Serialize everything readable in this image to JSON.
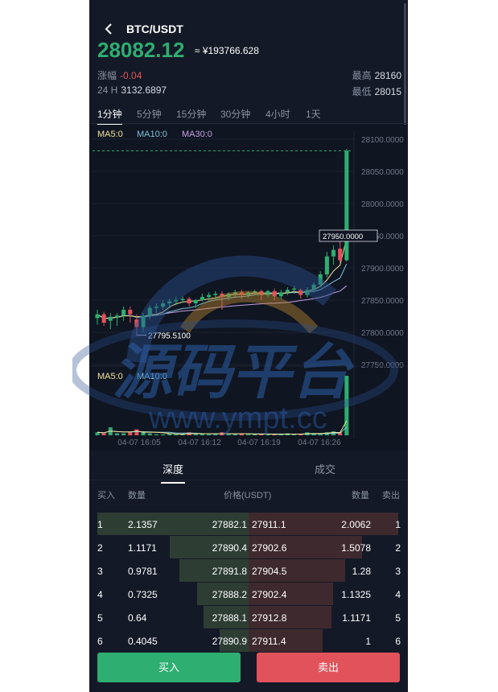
{
  "header": {
    "title": "BTC/USDT"
  },
  "price": {
    "last": "28082.12",
    "approx": "≈ ¥193766.628"
  },
  "stats": {
    "change_label": "涨幅",
    "change_value": "-0.04",
    "vol_label": "24 H",
    "vol_value": "3132.6897",
    "high_label": "最高",
    "high_value": "28160",
    "low_label": "最低",
    "low_value": "28015"
  },
  "intervals": [
    "1分钟",
    "5分钟",
    "15分钟",
    "30分钟",
    "4小时",
    "1天"
  ],
  "ma_main": {
    "ma5": "MA5:0",
    "ma10": "MA10:0",
    "ma30": "MA30:0"
  },
  "ma_vol": {
    "ma5": "MA5:0",
    "ma10": "MA10:0"
  },
  "chart_data": {
    "type": "candlestick",
    "y_ticks": [
      "28100.0000",
      "28050.0000",
      "28000.0000",
      "27950.0000",
      "27900.0000",
      "27850.0000",
      "27800.0000",
      "27750.0000"
    ],
    "ylim": [
      27750,
      28100
    ],
    "x_ticks": [
      "04-07 16:05",
      "04-07 16:12",
      "04-07 16:19",
      "04-07 16:26"
    ],
    "last_price_label": "27950.0000",
    "low_label": "27795.5100",
    "candles": [
      {
        "o": 27822,
        "h": 27835,
        "c": 27828,
        "l": 27812
      },
      {
        "o": 27828,
        "h": 27832,
        "c": 27815,
        "l": 27810
      },
      {
        "o": 27818,
        "h": 27830,
        "c": 27824,
        "l": 27805
      },
      {
        "o": 27823,
        "h": 27830,
        "c": 27826,
        "l": 27810
      },
      {
        "o": 27826,
        "h": 27840,
        "c": 27835,
        "l": 27818
      },
      {
        "o": 27835,
        "h": 27840,
        "c": 27828,
        "l": 27815
      },
      {
        "o": 27820,
        "h": 27828,
        "c": 27808,
        "l": 27795
      },
      {
        "o": 27808,
        "h": 27830,
        "c": 27826,
        "l": 27800
      },
      {
        "o": 27826,
        "h": 27842,
        "c": 27838,
        "l": 27820
      },
      {
        "o": 27838,
        "h": 27845,
        "c": 27840,
        "l": 27830
      },
      {
        "o": 27840,
        "h": 27850,
        "c": 27845,
        "l": 27835
      },
      {
        "o": 27845,
        "h": 27852,
        "c": 27848,
        "l": 27840
      },
      {
        "o": 27848,
        "h": 27855,
        "c": 27850,
        "l": 27842
      },
      {
        "o": 27850,
        "h": 27856,
        "c": 27852,
        "l": 27846
      },
      {
        "o": 27852,
        "h": 27855,
        "c": 27845,
        "l": 27840
      },
      {
        "o": 27845,
        "h": 27852,
        "c": 27850,
        "l": 27838
      },
      {
        "o": 27850,
        "h": 27860,
        "c": 27855,
        "l": 27848
      },
      {
        "o": 27855,
        "h": 27862,
        "c": 27858,
        "l": 27850
      },
      {
        "o": 27858,
        "h": 27864,
        "c": 27860,
        "l": 27852
      },
      {
        "o": 27860,
        "h": 27864,
        "c": 27855,
        "l": 27835
      },
      {
        "o": 27855,
        "h": 27862,
        "c": 27860,
        "l": 27850
      },
      {
        "o": 27860,
        "h": 27866,
        "c": 27862,
        "l": 27855
      },
      {
        "o": 27862,
        "h": 27866,
        "c": 27858,
        "l": 27852
      },
      {
        "o": 27858,
        "h": 27864,
        "c": 27862,
        "l": 27854
      },
      {
        "o": 27862,
        "h": 27866,
        "c": 27864,
        "l": 27858
      },
      {
        "o": 27864,
        "h": 27866,
        "c": 27858,
        "l": 27850
      },
      {
        "o": 27858,
        "h": 27866,
        "c": 27864,
        "l": 27854
      },
      {
        "o": 27864,
        "h": 27868,
        "c": 27856,
        "l": 27850
      },
      {
        "o": 27856,
        "h": 27866,
        "c": 27862,
        "l": 27852
      },
      {
        "o": 27862,
        "h": 27870,
        "c": 27866,
        "l": 27858
      },
      {
        "o": 27866,
        "h": 27872,
        "c": 27868,
        "l": 27860
      },
      {
        "o": 27866,
        "h": 27868,
        "c": 27858,
        "l": 27852
      },
      {
        "o": 27858,
        "h": 27870,
        "c": 27866,
        "l": 27854
      },
      {
        "o": 27866,
        "h": 27878,
        "c": 27874,
        "l": 27862
      },
      {
        "o": 27874,
        "h": 27895,
        "c": 27890,
        "l": 27870
      },
      {
        "o": 27890,
        "h": 27925,
        "c": 27918,
        "l": 27885
      },
      {
        "o": 27918,
        "h": 27935,
        "c": 27928,
        "l": 27905
      },
      {
        "o": 27930,
        "h": 27945,
        "c": 27912,
        "l": 27908
      },
      {
        "o": 27912,
        "h": 28085,
        "c": 28082,
        "l": 27910
      }
    ],
    "volumes": [
      3,
      2,
      8,
      2,
      2,
      3,
      6,
      3,
      2,
      1,
      1,
      2,
      1,
      1,
      3,
      1,
      2,
      1,
      1,
      3,
      1,
      1,
      2,
      1,
      1,
      1,
      1,
      1,
      1,
      2,
      1,
      1,
      3,
      2,
      2,
      3,
      4,
      3,
      60
    ]
  },
  "depth_tabs": [
    "深度",
    "成交"
  ],
  "orderbook": {
    "headers": {
      "buy": "买入",
      "qty": "数量",
      "price": "价格(USDT)",
      "qty2": "数量",
      "sell": "卖出"
    },
    "rows": [
      {
        "n": "1",
        "bq": "2.1357",
        "bp": "27882.1",
        "ap": "27911.1",
        "aq": "2.0062",
        "m": "1",
        "bd": 1.0,
        "ad": 0.99
      },
      {
        "n": "2",
        "bq": "1.1171",
        "bp": "27890.4",
        "ap": "27902.6",
        "aq": "1.5078",
        "m": "2",
        "bd": 0.52,
        "ad": 0.75
      },
      {
        "n": "3",
        "bq": "0.9781",
        "bp": "27891.8",
        "ap": "27904.5",
        "aq": "1.28",
        "m": "3",
        "bd": 0.46,
        "ad": 0.64
      },
      {
        "n": "4",
        "bq": "0.7325",
        "bp": "27888.2",
        "ap": "27902.4",
        "aq": "1.1325",
        "m": "4",
        "bd": 0.34,
        "ad": 0.56
      },
      {
        "n": "5",
        "bq": "0.64",
        "bp": "27888.1",
        "ap": "27912.8",
        "aq": "1.1171",
        "m": "5",
        "bd": 0.3,
        "ad": 0.55
      },
      {
        "n": "6",
        "bq": "0.4045",
        "bp": "27890.9",
        "ap": "27911.4",
        "aq": "1",
        "m": "6",
        "bd": 0.19,
        "ad": 0.49
      }
    ]
  },
  "actions": {
    "buy": "买入",
    "sell": "卖出"
  },
  "watermark": {
    "text1": "源码平台",
    "text2": "www.ympt.cc"
  },
  "colors": {
    "up": "#2eae71",
    "down": "#e2525b",
    "bg": "#131926"
  }
}
